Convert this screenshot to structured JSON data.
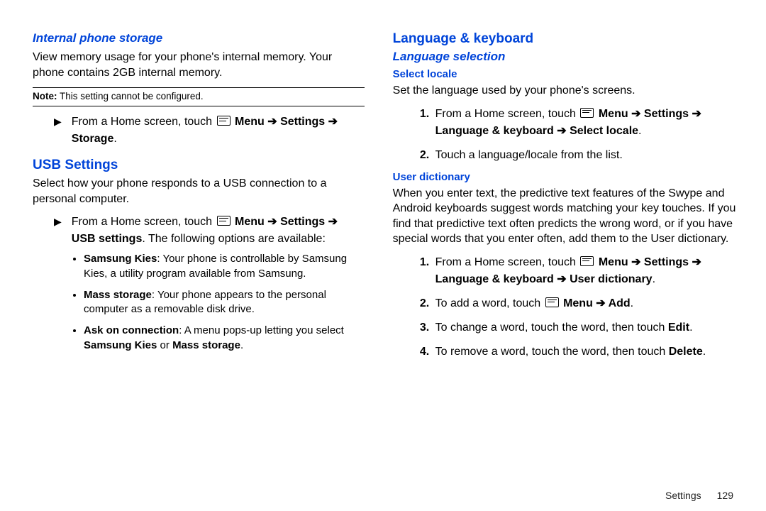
{
  "left": {
    "h_internal": "Internal phone storage",
    "p_internal": "View memory usage for your phone's internal memory. Your phone contains 2GB internal memory.",
    "note_label": "Note:",
    "note_text": " This setting cannot be configured.",
    "step_intro_prefix": "From a Home screen, touch ",
    "menu_word": "Menu",
    "arrow": " ➔ ",
    "settings_word": "Settings",
    "storage_word": "Storage",
    "period": ".",
    "h_usb": "USB Settings",
    "p_usb": "Select how your phone responds to a USB connection to a personal computer.",
    "usb_settings_label": "USB settings",
    "usb_following": ". The following options are available:",
    "bul1_label": "Samsung Kies",
    "bul1_text": ": Your phone is controllable by Samsung Kies, a utility program available from Samsung.",
    "bul2_label": "Mass storage",
    "bul2_text": ": Your phone appears to the personal computer as a removable disk drive.",
    "bul3_label": "Ask on connection",
    "bul3_text_a": ": A menu pops-up letting you select ",
    "bul3_sk": "Samsung Kies",
    "bul3_or": " or ",
    "bul3_ms": "Mass storage",
    "bul3_dot": "."
  },
  "right": {
    "h_lang": "Language & keyboard",
    "h_langsel": "Language selection",
    "h_locale": "Select locale",
    "p_locale": "Set the language used by your phone's screens.",
    "s1_prefix": "From a Home screen, touch ",
    "menu_word": "Menu",
    "arrow": " ➔ ",
    "settings_word": "Settings",
    "lk_word": "Language & keyboard",
    "sel_locale_word": "Select locale",
    "dot": ".",
    "s2": "Touch a language/locale from the list.",
    "h_userdict": "User dictionary",
    "p_userdict": "When you enter text, the predictive text features of the Swype and Android keyboards suggest words matching your key touches. If you find that predictive text often predicts the wrong word, or if you have special words that you enter often, add them to the User dictionary.",
    "ud_word": "User dictionary",
    "ud2_a": "To add a word, touch ",
    "ud2_add": "Add",
    "ud3_a": "To change a word, touch the word, then touch ",
    "ud3_edit": "Edit",
    "ud4_a": "To remove a word, touch the word, then touch ",
    "ud4_del": "Delete"
  },
  "footer": {
    "section": "Settings",
    "page": "129"
  }
}
